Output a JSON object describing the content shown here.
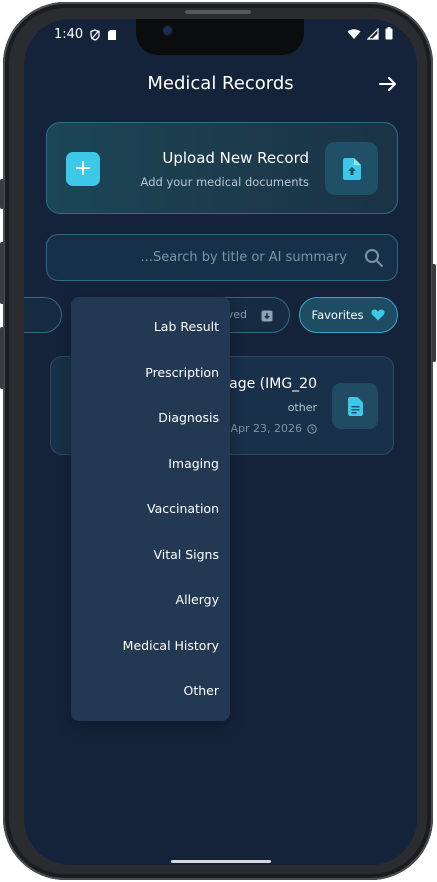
{
  "status_bar": {
    "time": "1:40"
  },
  "header": {
    "title": "Medical Records"
  },
  "upload": {
    "title": "Upload New Record",
    "subtitle": "Add your medical documents"
  },
  "search": {
    "placeholder": "Search by title or AI summary..."
  },
  "filters": {
    "archived_label": "Archived",
    "favorites_label": "Favorites"
  },
  "record": {
    "title": "Image (IMG_20",
    "type": "other",
    "date": "Apr 23, 2026"
  },
  "category_menu": {
    "items": [
      "Lab Result",
      "Prescription",
      "Diagnosis",
      "Imaging",
      "Vaccination",
      "Vital Signs",
      "Allergy",
      "Medical History",
      "Other"
    ]
  },
  "colors": {
    "accent": "#3cc8e6",
    "background": "#15233a",
    "card_border": "#2f6c82"
  }
}
